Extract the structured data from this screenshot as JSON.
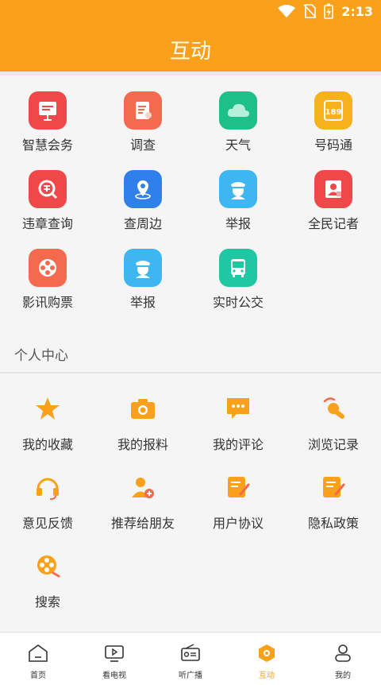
{
  "status_bar": {
    "time": "2:13"
  },
  "header": {
    "title": "互动"
  },
  "services": [
    {
      "label": "智慧会务",
      "icon": "presentation-board-icon",
      "color": "#f04848"
    },
    {
      "label": "调查",
      "icon": "survey-document-icon",
      "color": "#f46a4e"
    },
    {
      "label": "天气",
      "icon": "cloud-icon",
      "color": "#1cc088"
    },
    {
      "label": "号码通",
      "icon": "phone-number-icon",
      "color": "#f6b21d"
    },
    {
      "label": "违章查询",
      "icon": "violation-search-icon",
      "color": "#f04848"
    },
    {
      "label": "查周边",
      "icon": "location-pin-icon",
      "color": "#2f80ea"
    },
    {
      "label": "举报",
      "icon": "police-officer-icon",
      "color": "#3eb6f2"
    },
    {
      "label": "全民记者",
      "icon": "reporter-icon",
      "color": "#f04848"
    },
    {
      "label": "影讯购票",
      "icon": "film-reel-icon",
      "color": "#f46a4e"
    },
    {
      "label": "举报",
      "icon": "police-officer-icon",
      "color": "#3eb6f2"
    },
    {
      "label": "实时公交",
      "icon": "bus-icon",
      "color": "#1fc7a2"
    }
  ],
  "personal_center": {
    "title": "个人中心",
    "items": [
      {
        "label": "我的收藏",
        "icon": "star-icon"
      },
      {
        "label": "我的报料",
        "icon": "camera-icon"
      },
      {
        "label": "我的评论",
        "icon": "comment-icon"
      },
      {
        "label": "浏览记录",
        "icon": "history-icon"
      },
      {
        "label": "意见反馈",
        "icon": "headset-icon"
      },
      {
        "label": "推荐给朋友",
        "icon": "add-friend-icon"
      },
      {
        "label": "用户协议",
        "icon": "agreement-icon"
      },
      {
        "label": "隐私政策",
        "icon": "privacy-policy-icon"
      },
      {
        "label": "搜索",
        "icon": "search-reel-icon"
      }
    ]
  },
  "bottom_nav": [
    {
      "label": "首页",
      "icon": "home-icon",
      "active": false
    },
    {
      "label": "看电视",
      "icon": "tv-icon",
      "active": false
    },
    {
      "label": "听广播",
      "icon": "radio-icon",
      "active": false
    },
    {
      "label": "互动",
      "icon": "interaction-icon",
      "active": true
    },
    {
      "label": "我的",
      "icon": "profile-icon",
      "active": false
    }
  ],
  "colors": {
    "accent": "#f9a11b",
    "background": "#f5f5f5"
  }
}
